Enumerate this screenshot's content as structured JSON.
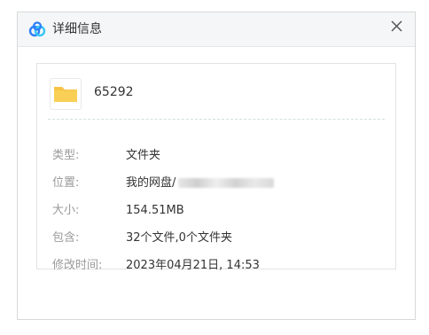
{
  "dialog": {
    "title": "详细信息",
    "app_icon": "baidu-netdisk-cloud-icon",
    "close_icon": "close-icon"
  },
  "file": {
    "icon": "folder-icon",
    "name": "65292"
  },
  "details": [
    {
      "label": "类型:",
      "value": "文件夹"
    },
    {
      "label": "位置:",
      "value": "我的网盘/"
    },
    {
      "label": "大小:",
      "value": "154.51MB"
    },
    {
      "label": "包含:",
      "value": "32个文件,0个文件夹"
    },
    {
      "label": "修改时间:",
      "value": "2023年04月21日, 14:53"
    }
  ],
  "colors": {
    "folder": "#f6c445",
    "brand_blue": "#2d7ff9",
    "label_gray": "#9a9a9a",
    "text_dark": "#333333"
  }
}
